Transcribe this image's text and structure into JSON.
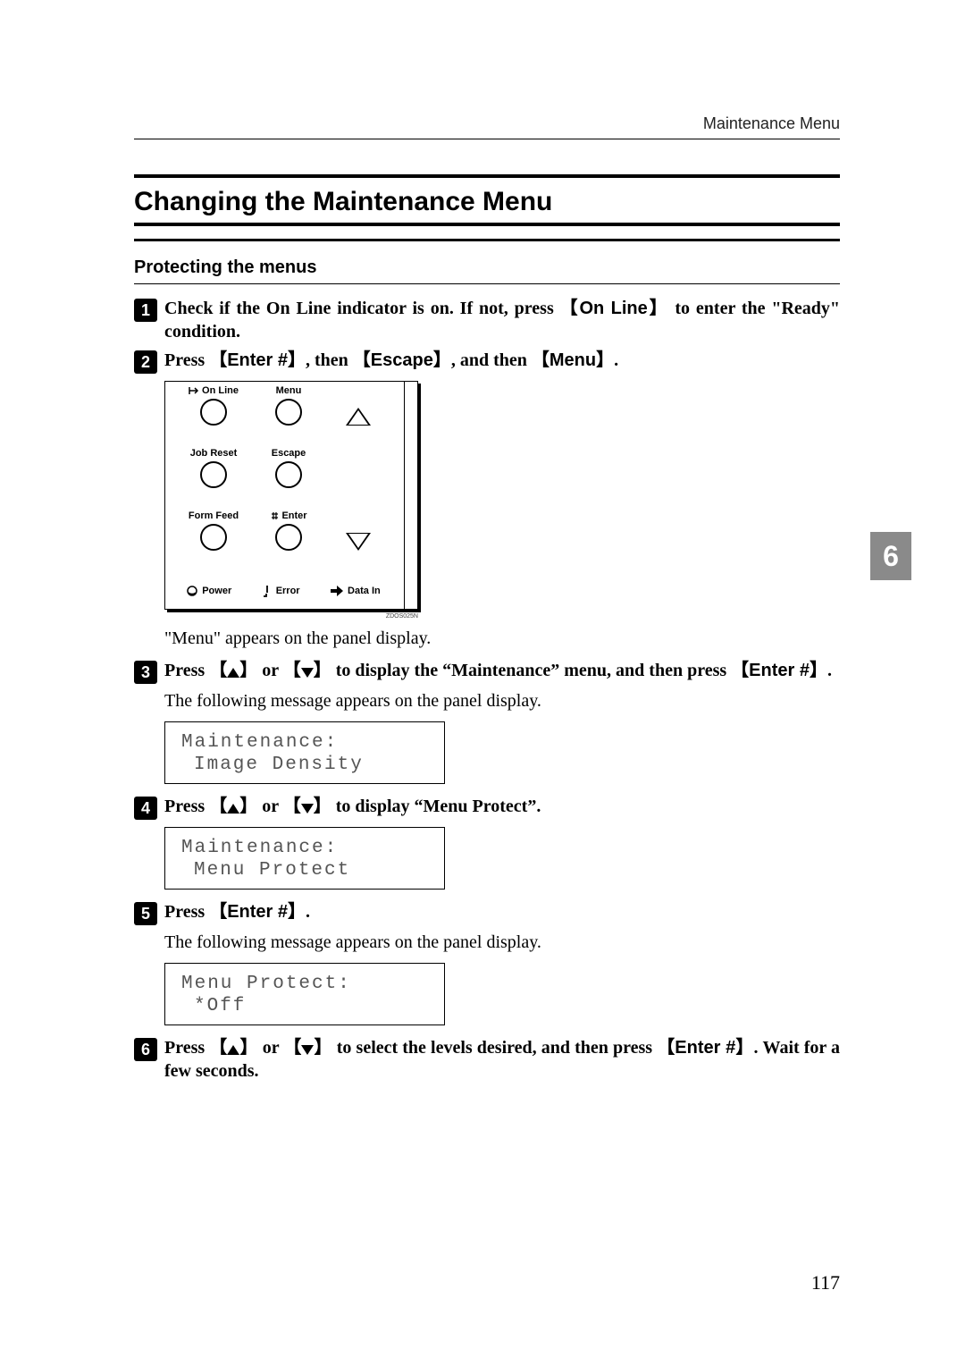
{
  "running_head": "Maintenance Menu",
  "h2": "Changing the Maintenance Menu",
  "h3": "Protecting the menus",
  "steps": {
    "s1a": "Check if the On Line indicator is on. If not, press ",
    "s1k": "On Line",
    "s1b": " to enter the \"Ready\" condition.",
    "s2a": "Press ",
    "s2k1": "Enter #",
    "s2b": ", then ",
    "s2k2": "Escape",
    "s2c": ", and then ",
    "s2k3": "Menu",
    "s2d": ".",
    "s3a": "Press ",
    "s3b": " or ",
    "s3c": " to display the “Maintenance” menu, and then press ",
    "s3k": "Enter #",
    "s3d": ".",
    "s4a": "Press ",
    "s4b": " or ",
    "s4c": " to display “Menu Protect”.",
    "s5a": "Press ",
    "s5k": "Enter #",
    "s5b": ".",
    "s6a": "Press ",
    "s6b": " or ",
    "s6c": " to select the levels desired, and then press ",
    "s6k": "Enter #",
    "s6d": ". Wait for a few seconds."
  },
  "panel": {
    "online": "On Line",
    "menu": "Menu",
    "jobreset": "Job Reset",
    "escape": "Escape",
    "formfeed": "Form Feed",
    "enter": "Enter",
    "power": "Power",
    "error": "Error",
    "datain": "Data In",
    "code": "ZDOS025N"
  },
  "body": {
    "after_panel": "\"Menu\" appears on the panel display.",
    "after_s3": "The following message appears on the panel display.",
    "after_s5": "The following message appears on the panel display."
  },
  "lcd1": {
    "l1": "Maintenance:",
    "l2": "Image Density"
  },
  "lcd2": {
    "l1": "Maintenance:",
    "l2": "Menu Protect"
  },
  "lcd3": {
    "l1": "Menu Protect:",
    "l2": "*Off"
  },
  "side_tab": "6",
  "page_number": "117",
  "hash": "#"
}
